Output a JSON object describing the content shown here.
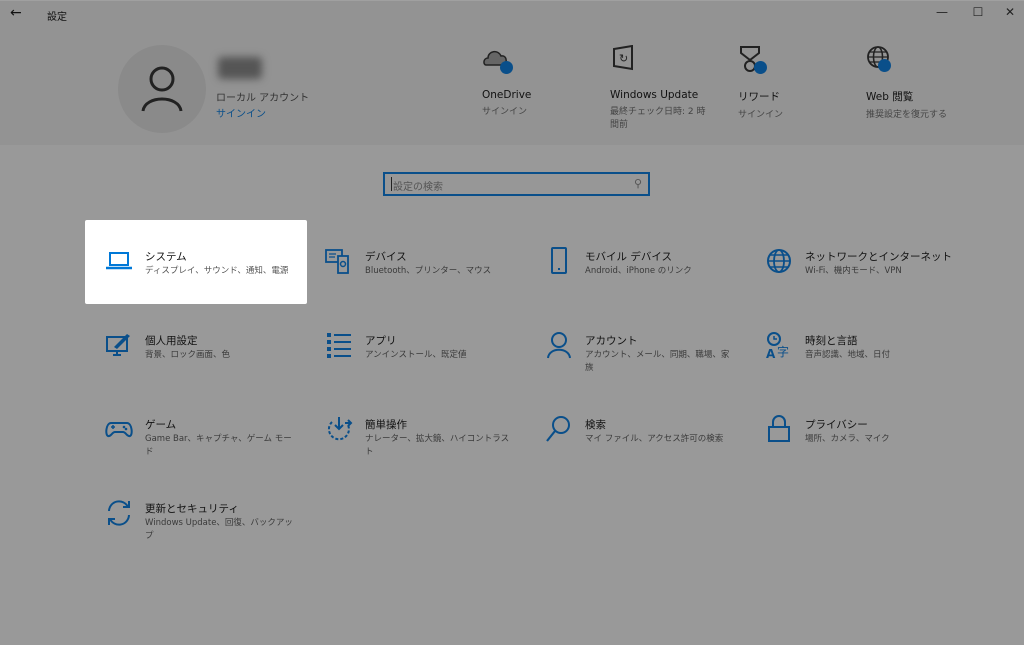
{
  "window": {
    "title": "設定",
    "back": "←",
    "minimize": "—",
    "maximize": "☐",
    "close": "✕"
  },
  "account": {
    "type": "ローカル アカウント",
    "signin": "サインイン"
  },
  "header_items": [
    {
      "label": "OneDrive",
      "sub": "サインイン",
      "icon": "cloud-icon"
    },
    {
      "label": "Windows Update",
      "sub": "最終チェック日時: 2 時間前",
      "icon": "update-icon"
    },
    {
      "label": "リワード",
      "sub": "サインイン",
      "icon": "rewards-icon"
    },
    {
      "label": "Web 閲覧",
      "sub": "推奨設定を復元する",
      "icon": "globe-icon"
    }
  ],
  "search": {
    "placeholder": "設定の検索",
    "icon": "search-icon"
  },
  "tiles": [
    {
      "title": "システム",
      "sub": "ディスプレイ、サウンド、通知、電源",
      "icon": "laptop-icon"
    },
    {
      "title": "デバイス",
      "sub": "Bluetooth、プリンター、マウス",
      "icon": "devices-icon"
    },
    {
      "title": "モバイル デバイス",
      "sub": "Android、iPhone のリンク",
      "icon": "phone-icon"
    },
    {
      "title": "ネットワークとインターネット",
      "sub": "Wi-Fi、機内モード、VPN",
      "icon": "globe-icon"
    },
    {
      "title": "個人用設定",
      "sub": "背景、ロック画面、色",
      "icon": "personalization-icon"
    },
    {
      "title": "アプリ",
      "sub": "アンインストール、既定値",
      "icon": "apps-list-icon"
    },
    {
      "title": "アカウント",
      "sub": "アカウント、メール、同期、職場、家族",
      "icon": "person-icon"
    },
    {
      "title": "時刻と言語",
      "sub": "音声認識、地域、日付",
      "icon": "time-language-icon"
    },
    {
      "title": "ゲーム",
      "sub": "Game Bar、キャプチャ、ゲーム モード",
      "icon": "gamepad-icon"
    },
    {
      "title": "簡単操作",
      "sub": "ナレーター、拡大鏡、ハイコントラスト",
      "icon": "ease-of-access-icon"
    },
    {
      "title": "検索",
      "sub": "マイ ファイル、アクセス許可の検索",
      "icon": "search-icon"
    },
    {
      "title": "プライバシー",
      "sub": "場所、カメラ、マイク",
      "icon": "lock-icon"
    },
    {
      "title": "更新とセキュリティ",
      "sub": "Windows Update、回復、バックアップ",
      "icon": "sync-icon"
    }
  ],
  "colors": {
    "accent": "#0078d7",
    "dimmed_accent": "#0a4f8a",
    "overlay": "#999999"
  }
}
